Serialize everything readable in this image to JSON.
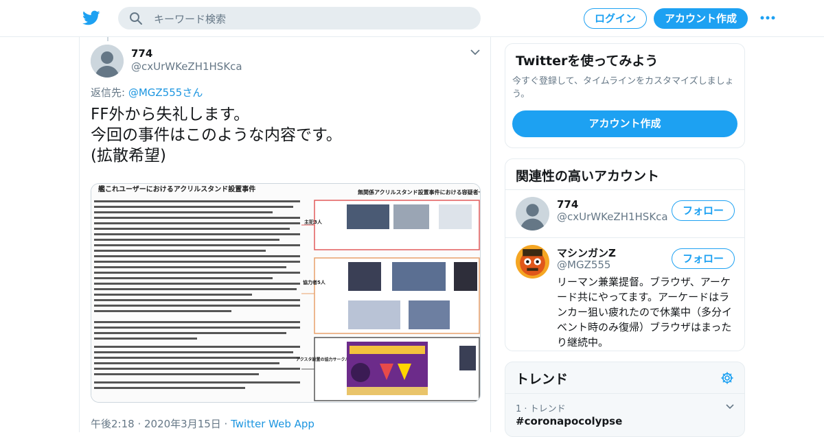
{
  "header": {
    "search_placeholder": "キーワード検索",
    "login_label": "ログイン",
    "signup_label": "アカウント作成"
  },
  "tweet": {
    "user_name": "774",
    "user_handle": "@cxUrWKeZH1HSKca",
    "reply_prefix": "返信先: ",
    "reply_target": "@MGZ555",
    "reply_suffix": "さん",
    "text": "FF外から失礼します。\n今回の事件はこのような内容です。\n(拡散希望)",
    "meta_time": "午後2:18 · 2020年3月15日 · ",
    "meta_source": "Twitter Web App",
    "image": {
      "left_title": "艦これユーザーにおけるアクリルスタンド設置事件",
      "right_title": "無関係アクリルスタンド設置事件における容疑者一覧",
      "section_main": "主犯3人",
      "section_coop": "協力者5人",
      "section_circle": "アクスタ設置の協力サークル"
    }
  },
  "sidebar": {
    "try": {
      "title": "Twitterを使ってみよう",
      "desc": "今すぐ登録して、タイムラインをカスタマイズしましょう。",
      "button": "アカウント作成"
    },
    "related": {
      "title": "関連性の高いアカウント",
      "accounts": [
        {
          "name": "774",
          "handle": "@cxUrWKeZH1HSKca",
          "follow": "フォロー"
        },
        {
          "name": "マシンガンZ",
          "handle": "@MGZ555",
          "follow": "フォロー",
          "bio": "リーマン兼業提督。ブラウザ、アーケード共にやってます。アーケードはランカー狙い疲れたので休業中（多分イベント時のみ復帰）ブラウザはまったり継続中。"
        }
      ]
    },
    "trends": {
      "title": "トレンド",
      "items": [
        {
          "rank": "1 · トレンド",
          "name": "#coronapocolypse"
        }
      ]
    }
  },
  "colors": {
    "accent": "#1da1f2",
    "link": "#1b95e0",
    "muted": "#657786",
    "border": "#e6ecf0"
  }
}
